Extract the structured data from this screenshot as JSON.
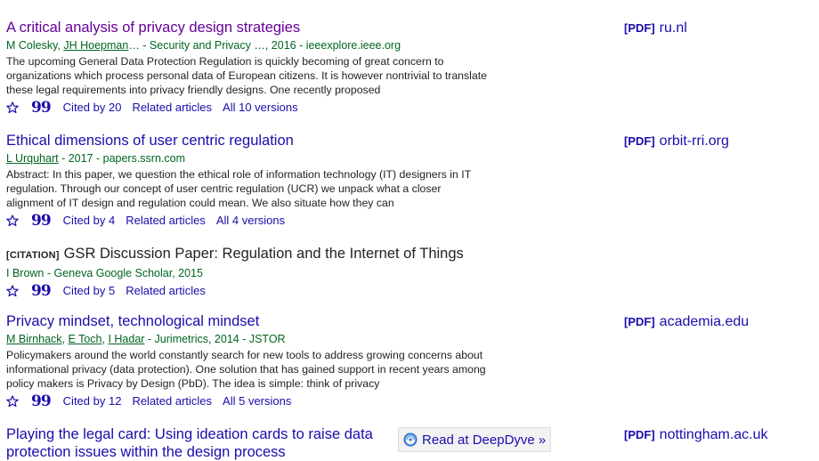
{
  "results": [
    {
      "title": "A critical analysis of privacy design strategies",
      "authors": [
        {
          "name": "M Colesky",
          "linked": false
        },
        {
          "name": "JH Hoepman",
          "linked": true
        }
      ],
      "authors_suffix": "… - Security and Privacy …, 2016 - ieeexplore.ieee.org",
      "snippet": "The upcoming General Data Protection Regulation is quickly becoming of great concern to organizations which process personal data of European citizens. It is however nontrivial to translate these legal requirements into privacy friendly designs. One recently proposed",
      "cited_by": "Cited by 20",
      "related": "Related articles",
      "versions": "All 10 versions",
      "pdf_label": "[PDF]",
      "pdf_domain": "ru.nl"
    },
    {
      "title": "Ethical dimensions of user centric regulation",
      "authors": [
        {
          "name": "L Urquhart",
          "linked": true
        }
      ],
      "authors_suffix": " - 2017 - papers.ssrn.com",
      "snippet": "Abstract: In this paper, we question the ethical role of information technology (IT) designers in IT regulation. Through our concept of user centric regulation (UCR) we unpack what a closer alignment of IT design and regulation could mean. We also situate how they can",
      "cited_by": "Cited by 4",
      "related": "Related articles",
      "versions": "All 4 versions",
      "pdf_label": "[PDF]",
      "pdf_domain": "orbit-rri.org"
    },
    {
      "citation_tag": "[CITATION]",
      "title": "GSR Discussion Paper: Regulation and the Internet of Things",
      "authors_text": "I Brown - Geneva Google Scholar, 2015",
      "cited_by": "Cited by 5",
      "related": "Related articles"
    },
    {
      "title": "Privacy mindset, technological mindset",
      "authors": [
        {
          "name": "M Birnhack",
          "linked": true
        },
        {
          "name": "E Toch",
          "linked": true
        },
        {
          "name": "I Hadar",
          "linked": true
        }
      ],
      "authors_suffix": " - Jurimetrics, 2014 - JSTOR",
      "snippet": "Policymakers around the world constantly search for new tools to address growing concerns about informational privacy (data protection). One solution that has gained support in recent years among policy makers is Privacy by Design (PbD). The idea is simple: think of privacy",
      "cited_by": "Cited by 12",
      "related": "Related articles",
      "versions": "All 5 versions",
      "pdf_label": "[PDF]",
      "pdf_domain": "academia.edu"
    },
    {
      "title": "Playing the legal card: Using ideation cards to raise data protection issues within the design process",
      "pdf_label": "[PDF]",
      "pdf_domain": "nottingham.ac.uk",
      "deepdyve_label": "Read at DeepDyve »"
    }
  ],
  "colors": {
    "link": "#1a0dab",
    "visited": "#660099",
    "green": "#006621",
    "text": "#222222"
  }
}
